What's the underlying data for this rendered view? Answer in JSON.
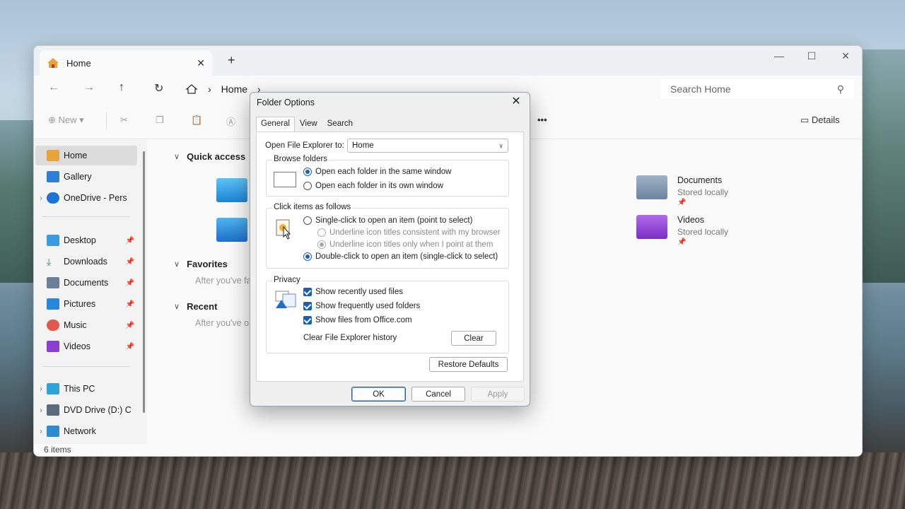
{
  "explorer": {
    "tab_title": "Home",
    "new_tab": "+",
    "address": [
      "Home"
    ],
    "search_placeholder": "Search Home",
    "commands": {
      "new_label": "New",
      "more_label": "•••",
      "details_label": "Details"
    },
    "sidebar": {
      "items": [
        {
          "label": "Home"
        },
        {
          "label": "Gallery"
        },
        {
          "label": "OneDrive - Pers"
        },
        {
          "label": "Desktop"
        },
        {
          "label": "Downloads"
        },
        {
          "label": "Documents"
        },
        {
          "label": "Pictures"
        },
        {
          "label": "Music"
        },
        {
          "label": "Videos"
        },
        {
          "label": "This PC"
        },
        {
          "label": "DVD Drive (D:) C"
        },
        {
          "label": "Network"
        }
      ]
    },
    "sections": {
      "quick_access": "Quick access",
      "favorites": "Favorites",
      "favorites_note": "After you've fa",
      "recent": "Recent",
      "recent_note": "After you've o"
    },
    "tiles": [
      {
        "name": "Documents",
        "sub": "Stored locally"
      },
      {
        "name": "Videos",
        "sub": "Stored locally"
      }
    ],
    "status": "6 items"
  },
  "dialog": {
    "title": "Folder Options",
    "tabs": [
      "General",
      "View",
      "Search"
    ],
    "open_label": "Open File Explorer to:",
    "open_value": "Home",
    "browse": {
      "label": "Browse folders",
      "opt1": "Open each folder in the same window",
      "opt2": "Open each folder in its own window"
    },
    "click": {
      "label": "Click items as follows",
      "opt1": "Single-click to open an item (point to select)",
      "sub1": "Underline icon titles consistent with my browser",
      "sub2": "Underline icon titles only when I point at them",
      "opt2": "Double-click to open an item (single-click to select)"
    },
    "privacy": {
      "label": "Privacy",
      "chk1": "Show recently used files",
      "chk2": "Show frequently used folders",
      "chk3": "Show files from Office.com",
      "clear_label": "Clear File Explorer history",
      "clear_btn": "Clear"
    },
    "restore_btn": "Restore Defaults",
    "ok": "OK",
    "cancel": "Cancel",
    "apply": "Apply"
  },
  "colors": {
    "accent": "#1a5fb4"
  }
}
